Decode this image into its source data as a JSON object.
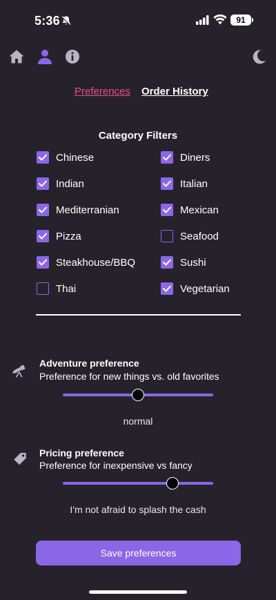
{
  "status_bar": {
    "time": "5:36",
    "battery": "91"
  },
  "nav": {
    "icons": [
      "home-icon",
      "user-icon",
      "info-icon",
      "moon-icon"
    ]
  },
  "tabs": {
    "preferences": "Preferences",
    "order_history": "Order History"
  },
  "filters": {
    "title": "Category Filters",
    "left": [
      {
        "label": "Chinese",
        "checked": true
      },
      {
        "label": "Indian",
        "checked": true
      },
      {
        "label": "Mediterranian",
        "checked": true
      },
      {
        "label": "Pizza",
        "checked": true
      },
      {
        "label": "Steakhouse/BBQ",
        "checked": true
      },
      {
        "label": "Thai",
        "checked": false
      }
    ],
    "right": [
      {
        "label": "Diners",
        "checked": true
      },
      {
        "label": "Italian",
        "checked": true
      },
      {
        "label": "Mexican",
        "checked": true
      },
      {
        "label": "Seafood",
        "checked": false
      },
      {
        "label": "Sushi",
        "checked": true
      },
      {
        "label": "Vegetarian",
        "checked": true
      }
    ]
  },
  "adventure": {
    "title": "Adventure preference",
    "description": "Preference for new things vs. old favorites",
    "level": 0.5,
    "value_label": "normal"
  },
  "pricing": {
    "title": "Pricing preference",
    "description": "Preference for inexpensive vs fancy",
    "level": 0.73,
    "value_label": "I'm not afraid to splash the cash"
  },
  "save_button": "Save preferences",
  "colors": {
    "background": "#26222c",
    "accent": "#8b67e8",
    "active_tab": "#e94f8a"
  }
}
